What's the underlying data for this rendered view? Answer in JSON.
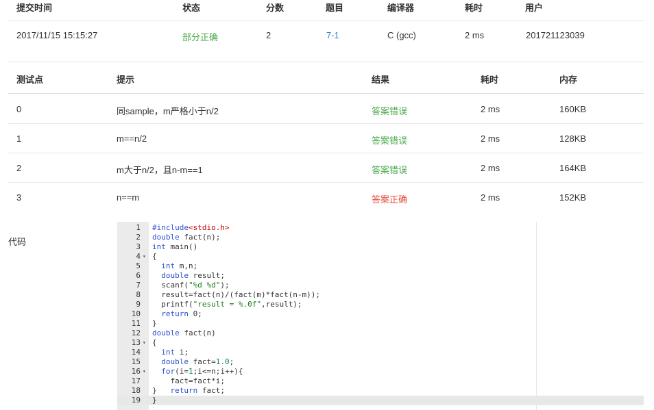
{
  "submission": {
    "headers": {
      "time": "提交时间",
      "status": "状态",
      "score": "分数",
      "problem": "题目",
      "compiler": "编译器",
      "elapsed": "耗时",
      "user": "用户"
    },
    "row": {
      "time": "2017/11/15 15:15:27",
      "status": "部分正确",
      "score": "2",
      "problem": "7-1",
      "compiler": "C (gcc)",
      "elapsed": "2 ms",
      "user": "201721123039"
    }
  },
  "testcases": {
    "headers": {
      "id": "测试点",
      "hint": "提示",
      "result": "结果",
      "elapsed": "耗时",
      "memory": "内存"
    },
    "rows": [
      {
        "id": "0",
        "hint": "同sample，m严格小于n/2",
        "result": "答案错误",
        "elapsed": "2 ms",
        "memory": "160KB"
      },
      {
        "id": "1",
        "hint": "m==n/2",
        "result": "答案错误",
        "elapsed": "2 ms",
        "memory": "128KB"
      },
      {
        "id": "2",
        "hint": "m大于n/2，且n-m==1",
        "result": "答案错误",
        "elapsed": "2 ms",
        "memory": "164KB"
      },
      {
        "id": "3",
        "hint": "n==m",
        "result": "答案正确",
        "elapsed": "2 ms",
        "memory": "152KB"
      }
    ]
  },
  "colors": {
    "partial": "#4aaa4a",
    "wrong": "#4aaa4a",
    "accepted": "#e64b3d",
    "link": "#3a7fc1"
  },
  "code": {
    "label": "代码",
    "active_line": 19,
    "folds": [
      4,
      13,
      16
    ],
    "lines": [
      "#include<stdio.h>",
      "double fact(n);",
      "int main()",
      "{",
      "  int m,n;",
      "  double result;",
      "  scanf(\"%d %d\");",
      "  result=fact(n)/(fact(m)*fact(n-m));",
      "  printf(\"result = %.0f\",result);",
      "  return 0;",
      "}",
      "double fact(n)",
      "{",
      "  int i;",
      "  double fact=1.0;",
      "  for(i=1;i<=n;i++){",
      "    fact=fact*i;",
      "}   return fact;",
      "}"
    ]
  }
}
